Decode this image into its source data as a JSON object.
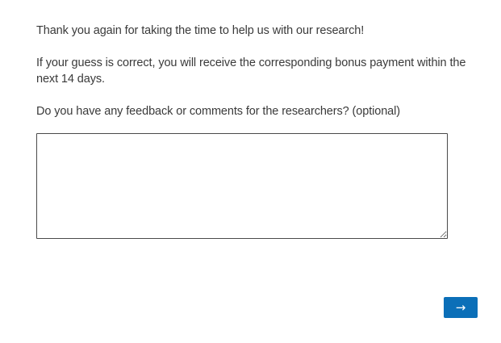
{
  "survey": {
    "thank_you_text": "Thank you again for taking the time to help us with our research!",
    "bonus_text": "If your guess is correct, you will receive the corresponding bonus payment within the next 14 days.",
    "feedback_question": "Do you have any feedback or comments for the researchers? (optional)",
    "feedback_value": "",
    "next_button_label": "→"
  },
  "colors": {
    "next_button_bg": "#0b6fb8",
    "text": "#3a3a3a"
  }
}
